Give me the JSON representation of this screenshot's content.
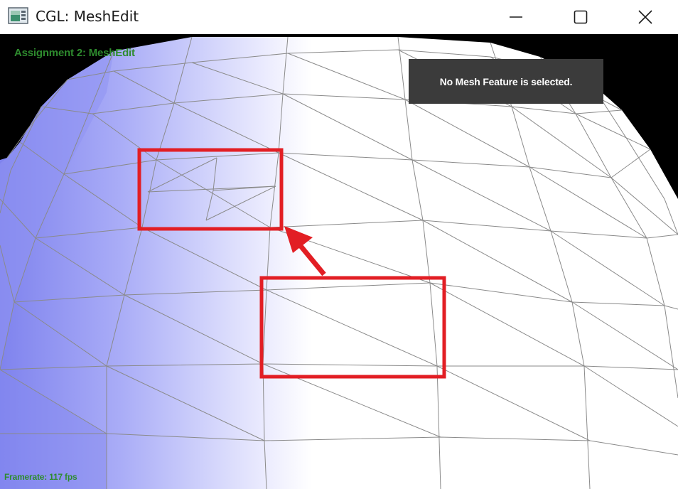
{
  "window": {
    "title": "CGL: MeshEdit"
  },
  "viewport": {
    "assignment_label": "Assignment 2: MeshEdit",
    "framerate_label": "Framerate: 117 fps",
    "info_message": "No Mesh Feature is selected."
  },
  "colors": {
    "hud_text": "#2e8b2e",
    "annotation_red": "#e21e24",
    "panel_bg": "#3b3b3b",
    "mesh_edge": "#8a8a8a"
  },
  "icons": {
    "app": "app-window-icon",
    "minimize": "minimize-icon",
    "maximize": "maximize-icon",
    "close": "close-icon"
  }
}
